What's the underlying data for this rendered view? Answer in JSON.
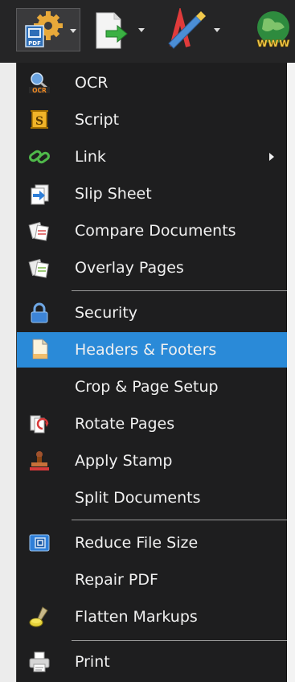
{
  "toolbar": {
    "buttons": [
      {
        "name": "tools-pdf-button",
        "icon": "pdf-gear-icon",
        "badge": "PDF"
      },
      {
        "name": "export-button",
        "icon": "document-arrow-icon"
      },
      {
        "name": "markup-button",
        "icon": "pen-text-icon"
      },
      {
        "name": "web-button",
        "icon": "globe-icon",
        "badge": "www"
      }
    ]
  },
  "menu": {
    "items": [
      {
        "label": "OCR",
        "icon": "ocr-icon",
        "badge": "OCR"
      },
      {
        "label": "Script",
        "icon": "script-icon",
        "badge": "S"
      },
      {
        "label": "Link",
        "icon": "link-icon",
        "submenu": true
      },
      {
        "label": "Slip Sheet",
        "icon": "slip-sheet-icon"
      },
      {
        "label": "Compare Documents",
        "icon": "compare-documents-icon"
      },
      {
        "label": "Overlay Pages",
        "icon": "overlay-pages-icon"
      },
      {
        "label": "Security",
        "icon": "lock-icon"
      },
      {
        "label": "Headers & Footers",
        "icon": "document-icon",
        "highlighted": true
      },
      {
        "label": "Crop & Page Setup",
        "icon": ""
      },
      {
        "label": "Rotate Pages",
        "icon": "rotate-pages-icon"
      },
      {
        "label": "Apply Stamp",
        "icon": "stamp-icon"
      },
      {
        "label": "Split Documents",
        "icon": ""
      },
      {
        "label": "Reduce File Size",
        "icon": "reduce-file-size-icon"
      },
      {
        "label": "Repair PDF",
        "icon": ""
      },
      {
        "label": "Flatten Markups",
        "icon": "flatten-markups-icon"
      },
      {
        "label": "Print",
        "icon": "printer-icon"
      }
    ]
  },
  "colors": {
    "menu_bg": "#1e1e1f",
    "highlight": "#2a8ad8",
    "text": "#f0f0f0",
    "separator": "#9a9a9a"
  }
}
